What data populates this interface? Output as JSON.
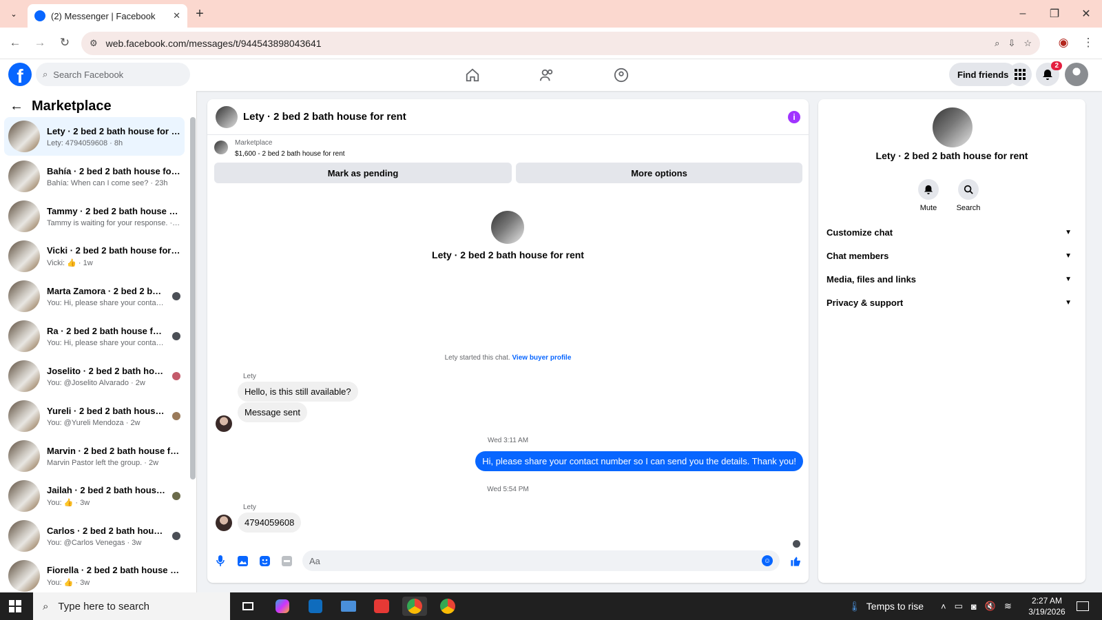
{
  "browser": {
    "tab_title": "(2) Messenger | Facebook",
    "url": "web.facebook.com/messages/t/944543898043641"
  },
  "facebook": {
    "search_placeholder": "Search Facebook",
    "find_friends": "Find friends",
    "notif_count": "2"
  },
  "sidebar": {
    "title": "Marketplace",
    "conversations": [
      {
        "name": "Lety · 2 bed 2 bath house for rent",
        "snippet": "Lety: 4794059608 · 8h"
      },
      {
        "name": "Bahía · 2 bed 2 bath house for r...",
        "snippet": "Bahía: When can I come see? · 23h"
      },
      {
        "name": "Tammy · 2 bed 2 bath house for...",
        "snippet": "Tammy is waiting for your response. · 1w"
      },
      {
        "name": "Vicki · 2 bed 2 bath house for re...",
        "snippet": "Vicki: 👍 · 1w"
      },
      {
        "name": "Marta Zamora · 2 bed 2 bath ...",
        "snippet": "You: Hi, please share your conta... · 1w"
      },
      {
        "name": "Ra · 2 bed 2 bath house for r...",
        "snippet": "You: Hi, please share your conta... · 1w"
      },
      {
        "name": "Joselito · 2 bed 2 bath house ...",
        "snippet": "You: @Joselito Alvarado · 2w"
      },
      {
        "name": "Yureli · 2 bed 2 bath house fo...",
        "snippet": "You: @Yureli Mendoza · 2w"
      },
      {
        "name": "Marvin · 2 bed 2 bath house for...",
        "snippet": "Marvin Pastor left the group. · 2w"
      },
      {
        "name": "Jailah · 2 bed 2 bath house fo...",
        "snippet": "You: 👍 · 3w"
      },
      {
        "name": "Carlos · 2 bed 2 bath house f...",
        "snippet": "You: @Carlos Venegas · 3w"
      },
      {
        "name": "Fiorella · 2 bed 2 bath house for...",
        "snippet": "You: 👍 · 3w"
      }
    ]
  },
  "chat": {
    "title": "Lety · 2 bed 2 bath house for rent",
    "marketplace_label": "Marketplace",
    "listing": "$1,600 - 2 bed 2 bath house for rent",
    "mark_pending": "Mark as pending",
    "more_options": "More options",
    "intro_name": "Lety · 2 bed 2 bath house for rent",
    "started_text": "Lety started this chat.",
    "view_buyer": "View buyer profile",
    "sender1": "Lety",
    "msg1": "Hello, is this still available?",
    "msg2": "Message sent",
    "time1": "Wed 3:11 AM",
    "msg_out": "Hi, please share your contact number so I can send you the details. Thank you!",
    "time2": "Wed 5:54 PM",
    "sender2": "Lety",
    "msg3": "4794059608",
    "composer_placeholder": "Aa"
  },
  "right_panel": {
    "name": "Lety · 2 bed 2 bath house for rent",
    "mute": "Mute",
    "search": "Search",
    "sections": [
      "Customize chat",
      "Chat members",
      "Media, files and links",
      "Privacy & support"
    ]
  },
  "taskbar": {
    "search_placeholder": "Type here to search",
    "weather": "Temps to rise",
    "time": "2:27 AM",
    "date": "3/19/2026"
  },
  "colors": {
    "brand": "#0866ff",
    "accent_purple": "#a033ff",
    "badge_red": "#e41e3f"
  }
}
